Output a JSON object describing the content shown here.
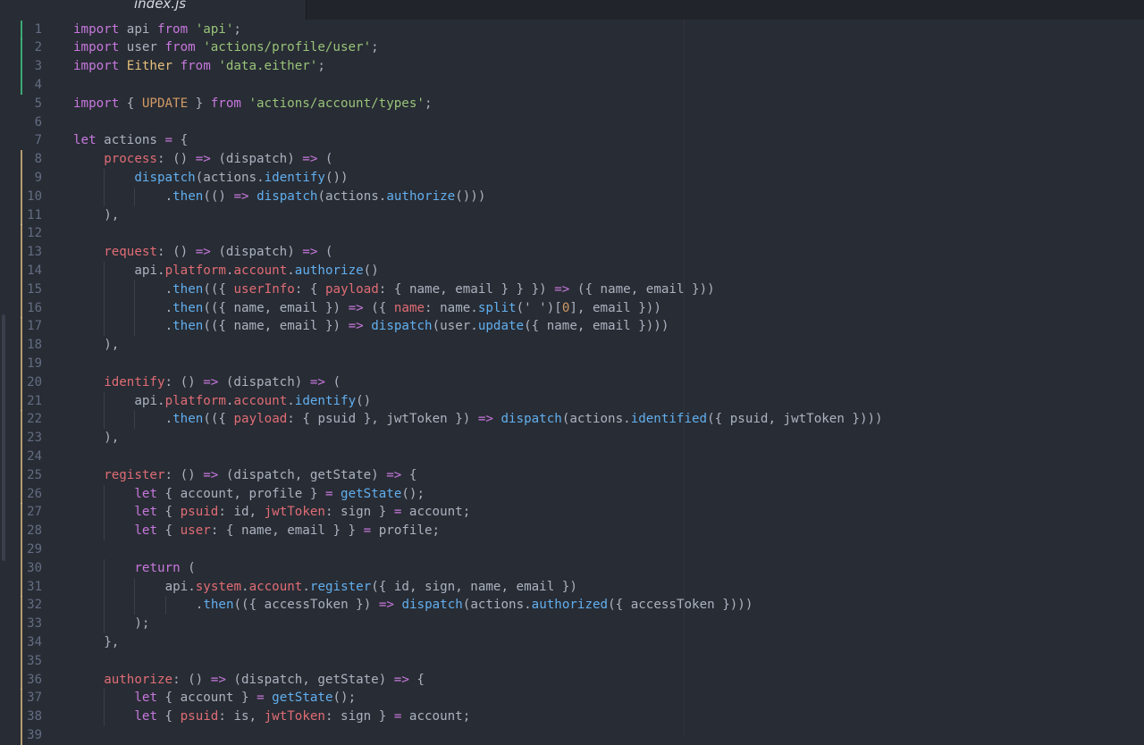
{
  "tab": {
    "title": "index.js"
  },
  "lines": [
    {
      "n": "1",
      "git": "added",
      "indent": 0,
      "tokens": [
        [
          "k",
          "import"
        ],
        [
          "t",
          " api "
        ],
        [
          "k",
          "from"
        ],
        [
          "t",
          " "
        ],
        [
          "s",
          "'api'"
        ],
        [
          "t",
          ";"
        ]
      ]
    },
    {
      "n": "2",
      "git": "added",
      "indent": 0,
      "tokens": [
        [
          "k",
          "import"
        ],
        [
          "t",
          " user "
        ],
        [
          "k",
          "from"
        ],
        [
          "t",
          " "
        ],
        [
          "s",
          "'actions/profile/user'"
        ],
        [
          "t",
          ";"
        ]
      ]
    },
    {
      "n": "3",
      "git": "added",
      "indent": 0,
      "tokens": [
        [
          "k",
          "import"
        ],
        [
          "t",
          " "
        ],
        [
          "c",
          "Either"
        ],
        [
          "t",
          " "
        ],
        [
          "k",
          "from"
        ],
        [
          "t",
          " "
        ],
        [
          "s",
          "'data.either'"
        ],
        [
          "t",
          ";"
        ]
      ]
    },
    {
      "n": "4",
      "git": "added",
      "indent": 0,
      "tokens": []
    },
    {
      "n": "5",
      "git": "",
      "indent": 0,
      "tokens": [
        [
          "k",
          "import"
        ],
        [
          "t",
          " { "
        ],
        [
          "n",
          "UPDATE"
        ],
        [
          "t",
          " } "
        ],
        [
          "k",
          "from"
        ],
        [
          "t",
          " "
        ],
        [
          "s",
          "'actions/account/types'"
        ],
        [
          "t",
          ";"
        ]
      ]
    },
    {
      "n": "6",
      "git": "",
      "indent": 0,
      "tokens": []
    },
    {
      "n": "7",
      "git": "",
      "indent": 0,
      "tokens": [
        [
          "k",
          "let"
        ],
        [
          "t",
          " actions "
        ],
        [
          "o",
          "="
        ],
        [
          "t",
          " {"
        ]
      ]
    },
    {
      "n": "8",
      "git": "modified",
      "indent": 1,
      "tokens": [
        [
          "p",
          "process"
        ],
        [
          "t",
          ": () "
        ],
        [
          "o",
          "=>"
        ],
        [
          "t",
          " (dispatch) "
        ],
        [
          "o",
          "=>"
        ],
        [
          "t",
          " ("
        ]
      ]
    },
    {
      "n": "9",
      "git": "modified",
      "indent": 2,
      "tokens": [
        [
          "f",
          "dispatch"
        ],
        [
          "t",
          "(actions."
        ],
        [
          "f",
          "identify"
        ],
        [
          "t",
          "())"
        ]
      ]
    },
    {
      "n": "10",
      "git": "modified",
      "indent": 3,
      "tokens": [
        [
          "t",
          "."
        ],
        [
          "f",
          "then"
        ],
        [
          "t",
          "(() "
        ],
        [
          "o",
          "=>"
        ],
        [
          "t",
          " "
        ],
        [
          "f",
          "dispatch"
        ],
        [
          "t",
          "(actions."
        ],
        [
          "f",
          "authorize"
        ],
        [
          "t",
          "()))"
        ]
      ]
    },
    {
      "n": "11",
      "git": "modified",
      "indent": 1,
      "tokens": [
        [
          "t",
          "),"
        ]
      ]
    },
    {
      "n": "12",
      "git": "modified",
      "indent": 0,
      "tokens": []
    },
    {
      "n": "13",
      "git": "modified",
      "indent": 1,
      "tokens": [
        [
          "p",
          "request"
        ],
        [
          "t",
          ": () "
        ],
        [
          "o",
          "=>"
        ],
        [
          "t",
          " (dispatch) "
        ],
        [
          "o",
          "=>"
        ],
        [
          "t",
          " ("
        ]
      ]
    },
    {
      "n": "14",
      "git": "modified",
      "indent": 2,
      "tokens": [
        [
          "t",
          "api."
        ],
        [
          "p",
          "platform"
        ],
        [
          "t",
          "."
        ],
        [
          "p",
          "account"
        ],
        [
          "t",
          "."
        ],
        [
          "f",
          "authorize"
        ],
        [
          "t",
          "()"
        ]
      ]
    },
    {
      "n": "15",
      "git": "modified",
      "indent": 3,
      "tokens": [
        [
          "t",
          "."
        ],
        [
          "f",
          "then"
        ],
        [
          "t",
          "(({ "
        ],
        [
          "p",
          "userInfo"
        ],
        [
          "t",
          ": { "
        ],
        [
          "p",
          "payload"
        ],
        [
          "t",
          ": { name, email } } }) "
        ],
        [
          "o",
          "=>"
        ],
        [
          "t",
          " ({ name, email }))"
        ]
      ]
    },
    {
      "n": "16",
      "git": "modified",
      "indent": 3,
      "tokens": [
        [
          "t",
          "."
        ],
        [
          "f",
          "then"
        ],
        [
          "t",
          "(({ name, email }) "
        ],
        [
          "o",
          "=>"
        ],
        [
          "t",
          " ({ "
        ],
        [
          "p",
          "name"
        ],
        [
          "t",
          ": name."
        ],
        [
          "f",
          "split"
        ],
        [
          "t",
          "(' ')["
        ],
        [
          "n",
          "0"
        ],
        [
          "t",
          "], email }))"
        ]
      ]
    },
    {
      "n": "17",
      "git": "modified",
      "indent": 3,
      "tokens": [
        [
          "t",
          "."
        ],
        [
          "f",
          "then"
        ],
        [
          "t",
          "(({ name, email }) "
        ],
        [
          "o",
          "=>"
        ],
        [
          "t",
          " "
        ],
        [
          "f",
          "dispatch"
        ],
        [
          "t",
          "(user."
        ],
        [
          "f",
          "update"
        ],
        [
          "t",
          "({ name, email })))"
        ]
      ]
    },
    {
      "n": "18",
      "git": "modified",
      "indent": 1,
      "tokens": [
        [
          "t",
          "),"
        ]
      ]
    },
    {
      "n": "19",
      "git": "modified",
      "indent": 0,
      "tokens": []
    },
    {
      "n": "20",
      "git": "modified",
      "indent": 1,
      "tokens": [
        [
          "p",
          "identify"
        ],
        [
          "t",
          ": () "
        ],
        [
          "o",
          "=>"
        ],
        [
          "t",
          " (dispatch) "
        ],
        [
          "o",
          "=>"
        ],
        [
          "t",
          " ("
        ]
      ]
    },
    {
      "n": "21",
      "git": "modified",
      "indent": 2,
      "tokens": [
        [
          "t",
          "api."
        ],
        [
          "p",
          "platform"
        ],
        [
          "t",
          "."
        ],
        [
          "p",
          "account"
        ],
        [
          "t",
          "."
        ],
        [
          "f",
          "identify"
        ],
        [
          "t",
          "()"
        ]
      ]
    },
    {
      "n": "22",
      "git": "modified",
      "indent": 3,
      "tokens": [
        [
          "t",
          "."
        ],
        [
          "f",
          "then"
        ],
        [
          "t",
          "(({ "
        ],
        [
          "p",
          "payload"
        ],
        [
          "t",
          ": { psuid }, jwtToken }) "
        ],
        [
          "o",
          "=>"
        ],
        [
          "t",
          " "
        ],
        [
          "f",
          "dispatch"
        ],
        [
          "t",
          "(actions."
        ],
        [
          "f",
          "identified"
        ],
        [
          "t",
          "({ psuid, jwtToken })))"
        ]
      ]
    },
    {
      "n": "23",
      "git": "modified",
      "indent": 1,
      "tokens": [
        [
          "t",
          "),"
        ]
      ]
    },
    {
      "n": "24",
      "git": "modified",
      "indent": 0,
      "tokens": []
    },
    {
      "n": "25",
      "git": "modified",
      "indent": 1,
      "tokens": [
        [
          "p",
          "register"
        ],
        [
          "t",
          ": () "
        ],
        [
          "o",
          "=>"
        ],
        [
          "t",
          " (dispatch, getState) "
        ],
        [
          "o",
          "=>"
        ],
        [
          "t",
          " {"
        ]
      ]
    },
    {
      "n": "26",
      "git": "modified",
      "indent": 2,
      "tokens": [
        [
          "k",
          "let"
        ],
        [
          "t",
          " { account, profile } "
        ],
        [
          "o",
          "="
        ],
        [
          "t",
          " "
        ],
        [
          "f",
          "getState"
        ],
        [
          "t",
          "();"
        ]
      ]
    },
    {
      "n": "27",
      "git": "modified",
      "indent": 2,
      "tokens": [
        [
          "k",
          "let"
        ],
        [
          "t",
          " { "
        ],
        [
          "p",
          "psuid"
        ],
        [
          "t",
          ": id, "
        ],
        [
          "p",
          "jwtToken"
        ],
        [
          "t",
          ": sign } "
        ],
        [
          "o",
          "="
        ],
        [
          "t",
          " account;"
        ]
      ]
    },
    {
      "n": "28",
      "git": "modified",
      "indent": 2,
      "tokens": [
        [
          "k",
          "let"
        ],
        [
          "t",
          " { "
        ],
        [
          "p",
          "user"
        ],
        [
          "t",
          ": { name, email } } "
        ],
        [
          "o",
          "="
        ],
        [
          "t",
          " profile;"
        ]
      ]
    },
    {
      "n": "29",
      "git": "modified",
      "indent": 0,
      "tokens": []
    },
    {
      "n": "30",
      "git": "modified",
      "indent": 2,
      "tokens": [
        [
          "k",
          "return"
        ],
        [
          "t",
          " ("
        ]
      ]
    },
    {
      "n": "31",
      "git": "modified",
      "indent": 3,
      "tokens": [
        [
          "t",
          "api."
        ],
        [
          "p",
          "system"
        ],
        [
          "t",
          "."
        ],
        [
          "p",
          "account"
        ],
        [
          "t",
          "."
        ],
        [
          "f",
          "register"
        ],
        [
          "t",
          "({ id, sign, name, email })"
        ]
      ]
    },
    {
      "n": "32",
      "git": "modified",
      "indent": 4,
      "tokens": [
        [
          "t",
          "."
        ],
        [
          "f",
          "then"
        ],
        [
          "t",
          "(({ accessToken }) "
        ],
        [
          "o",
          "=>"
        ],
        [
          "t",
          " "
        ],
        [
          "f",
          "dispatch"
        ],
        [
          "t",
          "(actions."
        ],
        [
          "f",
          "authorized"
        ],
        [
          "t",
          "({ accessToken })))"
        ]
      ]
    },
    {
      "n": "33",
      "git": "modified",
      "indent": 2,
      "tokens": [
        [
          "t",
          ");"
        ]
      ]
    },
    {
      "n": "34",
      "git": "modified",
      "indent": 1,
      "tokens": [
        [
          "t",
          "},"
        ]
      ]
    },
    {
      "n": "35",
      "git": "modified",
      "indent": 0,
      "tokens": []
    },
    {
      "n": "36",
      "git": "modified",
      "indent": 1,
      "tokens": [
        [
          "p",
          "authorize"
        ],
        [
          "t",
          ": () "
        ],
        [
          "o",
          "=>"
        ],
        [
          "t",
          " (dispatch, getState) "
        ],
        [
          "o",
          "=>"
        ],
        [
          "t",
          " {"
        ]
      ]
    },
    {
      "n": "37",
      "git": "modified",
      "indent": 2,
      "tokens": [
        [
          "k",
          "let"
        ],
        [
          "t",
          " { account } "
        ],
        [
          "o",
          "="
        ],
        [
          "t",
          " "
        ],
        [
          "f",
          "getState"
        ],
        [
          "t",
          "();"
        ]
      ]
    },
    {
      "n": "38",
      "git": "modified",
      "indent": 2,
      "tokens": [
        [
          "k",
          "let"
        ],
        [
          "t",
          " { "
        ],
        [
          "p",
          "psuid"
        ],
        [
          "t",
          ": is, "
        ],
        [
          "p",
          "jwtToken"
        ],
        [
          "t",
          ": sign } "
        ],
        [
          "o",
          "="
        ],
        [
          "t",
          " account;"
        ]
      ]
    },
    {
      "n": "39",
      "git": "modified",
      "indent": 0,
      "tokens": []
    }
  ]
}
